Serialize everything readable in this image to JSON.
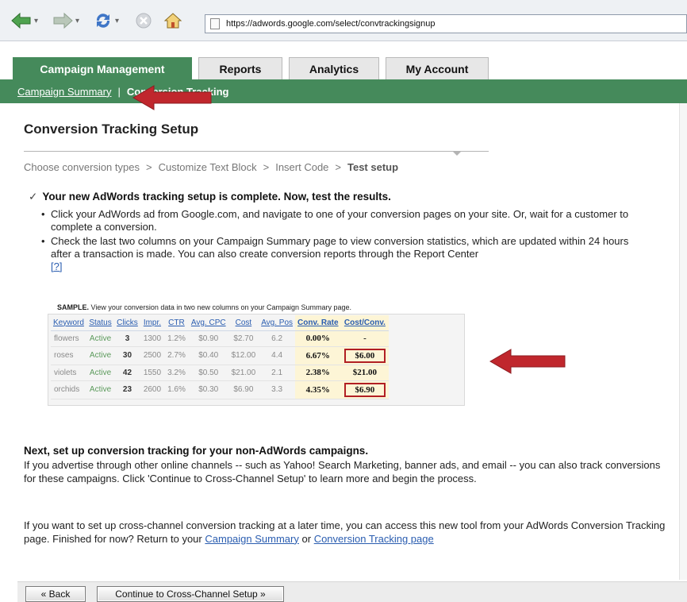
{
  "browser": {
    "url": "https://adwords.google.com/select/convtrackingsignup"
  },
  "tabs": [
    {
      "label": "Campaign Management"
    },
    {
      "label": "Reports"
    },
    {
      "label": "Analytics"
    },
    {
      "label": "My Account"
    }
  ],
  "subnav": {
    "link": "Campaign Summary",
    "separator": "|",
    "current": "Conversion Tracking"
  },
  "page": {
    "title": "Conversion Tracking Setup"
  },
  "steps": {
    "items": [
      "Choose conversion types",
      "Customize Text Block",
      "Insert Code",
      "Test setup"
    ],
    "separator": ">"
  },
  "status": {
    "check": "✓",
    "headline": "Your new AdWords tracking setup is complete. Now, test the results.",
    "bullet1": "Click your AdWords ad from Google.com, and navigate to one of your conversion pages on your site. Or, wait for a customer to complete a conversion.",
    "bullet2": "Check the last two columns on your Campaign Summary page to view conversion statistics, which are updated within 24 hours after a transaction is made. You can also create conversion reports through the Report Center",
    "help_link": "[?]"
  },
  "sample": {
    "caption_bold": "SAMPLE.",
    "caption_text": "View your conversion data in two new columns on your Campaign Summary page.",
    "headers": [
      "Keyword",
      "Status",
      "Clicks",
      "Impr.",
      "CTR",
      "Avg. CPC",
      "Cost",
      "Avg. Pos",
      "Conv. Rate",
      "Cost/Conv."
    ],
    "rows": [
      [
        "flowers",
        "Active",
        "3",
        "1300",
        "1.2%",
        "$0.90",
        "$2.70",
        "6.2",
        "0.00%",
        "-"
      ],
      [
        "roses",
        "Active",
        "30",
        "2500",
        "2.7%",
        "$0.40",
        "$12.00",
        "4.4",
        "6.67%",
        "$6.00"
      ],
      [
        "violets",
        "Active",
        "42",
        "1550",
        "3.2%",
        "$0.50",
        "$21.00",
        "2.1",
        "2.38%",
        "$21.00"
      ],
      [
        "orchids",
        "Active",
        "23",
        "2600",
        "1.6%",
        "$0.30",
        "$6.90",
        "3.3",
        "4.35%",
        "$6.90"
      ]
    ]
  },
  "next": {
    "headline": "Next, set up conversion tracking for your non-AdWords campaigns.",
    "paragraph1": "If you advertise through other online channels -- such as Yahoo! Search Marketing, banner ads, and email -- you can also track conversions for these campaigns. Click 'Continue to Cross-Channel Setup' to learn more and begin the process.",
    "paragraph2_pre": "If you want to set up cross-channel conversion tracking at a later time, you can access this new tool from your AdWords Conversion Tracking page. Finished for now? Return to your",
    "link_campaign_summary": "Campaign Summary",
    "paragraph2_or": "or",
    "link_conversion_tracking": "Conversion Tracking page"
  },
  "buttons": {
    "back": "« Back",
    "continue": "Continue to Cross-Channel Setup »"
  },
  "colors": {
    "green_tab": "#458a5b",
    "arrow_red": "#c0272d",
    "link_blue": "#2a5db0",
    "highlight": "#fdf5d6"
  }
}
